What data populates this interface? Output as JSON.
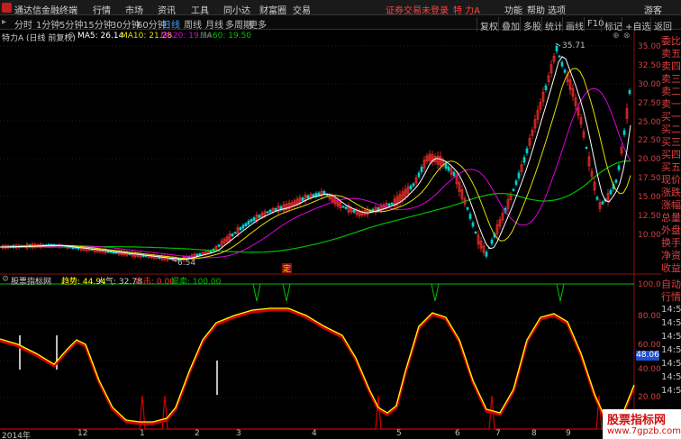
{
  "titlebar": {
    "app_name": "通达信金融终端",
    "menus": [
      "行情",
      "市场",
      "资讯",
      "工具",
      "同小达",
      "财富圈",
      "交易"
    ],
    "stock_status": "证券交易未登录",
    "stock_name": "特 力A",
    "right_menus": [
      "功能",
      "帮助",
      "选项",
      "游客"
    ]
  },
  "toolbar": {
    "periods": [
      "分时",
      "1分钟",
      "5分钟",
      "15分钟",
      "30分钟",
      "60分钟",
      "日线",
      "周线",
      "月线",
      "多周期",
      "更多"
    ],
    "buttons": [
      "复权",
      "叠加",
      "多股",
      "统计",
      "画线",
      "F10",
      "标记",
      "+自选",
      "返回"
    ]
  },
  "price_panel": {
    "stock_label": "特力A (日线 前复权)",
    "ma5": "MA5: 26.14",
    "ma10": "MA10: 21.28",
    "ma20": "MA20: 19.34",
    "ma60": "MA60: 19.50",
    "high_label": "35.71",
    "low_label": "6.54",
    "event_mark": "定",
    "y_ticks": [
      "35.00",
      "32.50",
      "30.00",
      "27.50",
      "25.00",
      "22.50",
      "20.00",
      "17.50",
      "15.00",
      "12.50",
      "10.00"
    ]
  },
  "right_side": {
    "items": [
      "委比",
      "卖五",
      "卖四",
      "卖三",
      "卖二",
      "卖一",
      "买一",
      "买二",
      "买三",
      "买四",
      "买五",
      "现价",
      "涨跌",
      "涨幅",
      "总量",
      "外盘",
      "换手",
      "净资",
      "收益"
    ],
    "items2": [
      "自动",
      "行情"
    ]
  },
  "indicator_panel": {
    "name": "股票指标网",
    "trend": "趋势: 44.94",
    "popularity": "人气: 32.78",
    "exit": "出击: 0.00",
    "sell": "提卖: 100.00",
    "y_ticks": [
      "100.0",
      "80.00",
      "60.00",
      "40.00",
      "20.00"
    ],
    "current_value": "48.06",
    "time_ticks": [
      "14:55",
      "14:55",
      "14:55",
      "14:55",
      "14:55",
      "14:55",
      "14:55",
      "14:55"
    ]
  },
  "x_axis": {
    "labels": [
      "2014年",
      "12",
      "1",
      "2",
      "3",
      "4",
      "5",
      "6",
      "7",
      "8",
      "9"
    ]
  },
  "watermark": {
    "title": "股票指标网",
    "url": "www.7gpzb.com"
  },
  "colors": {
    "up": "#ff3030",
    "down": "#00d0d0",
    "ma5": "#ffffff",
    "ma10": "#e0e000",
    "ma20": "#e000e0",
    "ma60": "#00c000",
    "indicator_yellow": "#ffff00",
    "indicator_red": "#d00000"
  }
}
